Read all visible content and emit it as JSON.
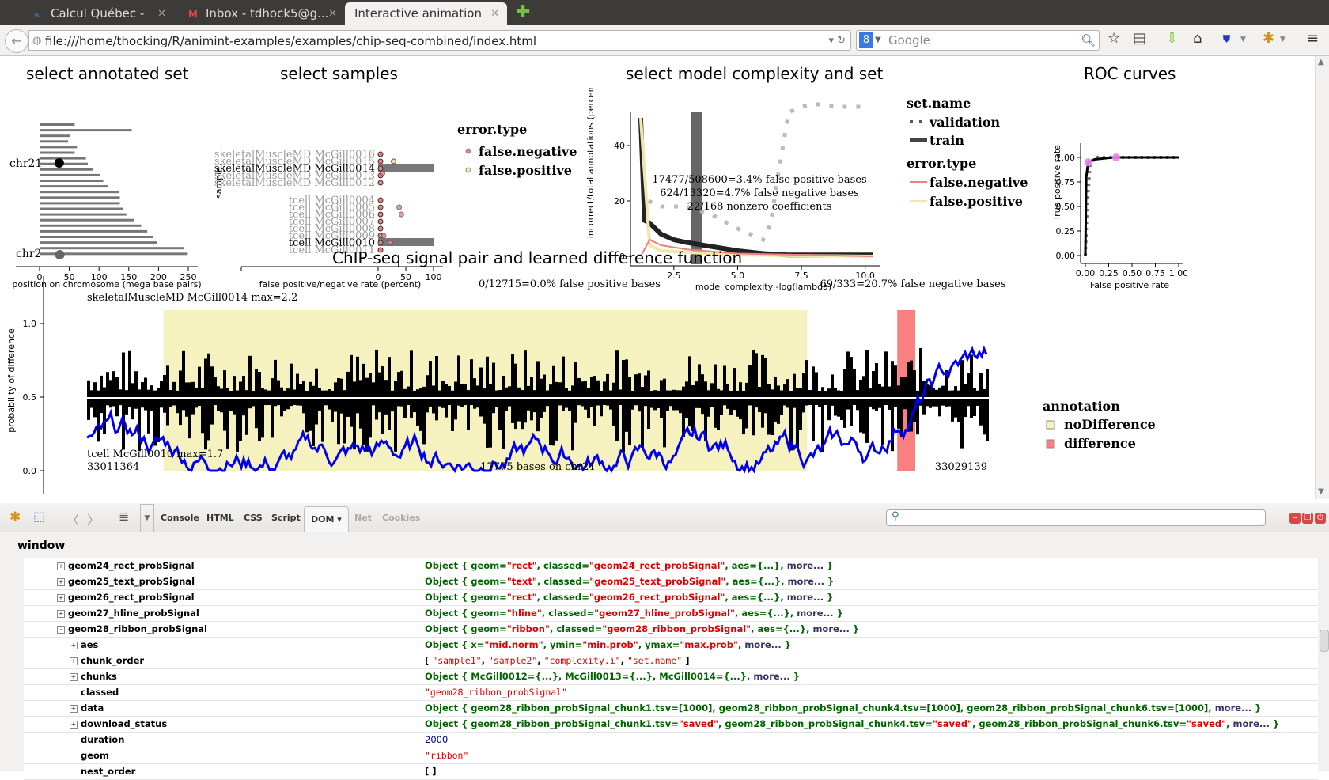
{
  "browser": {
    "tabs": [
      {
        "label": "Calcul Québec - Das...",
        "icon": "calculquebec-icon",
        "active": false
      },
      {
        "label": "Inbox - tdhock5@g...",
        "icon": "gmail-icon",
        "active": false
      },
      {
        "label": "Interactive animation",
        "icon": "",
        "active": true
      }
    ],
    "url": "file:///home/thocking/R/animint-examples/examples/chip-seq-combined/index.html",
    "search_placeholder": "Google"
  },
  "plots": {
    "annotated_set": {
      "title": "select annotated set",
      "xlabel": "position on chromosome (mega base pairs)",
      "xticks": [
        "0",
        "50",
        "100",
        "150",
        "200",
        "250"
      ],
      "labels": [
        "chr21",
        "chr2"
      ]
    },
    "samples": {
      "title": "select samples",
      "ylabel": "sample",
      "xlabel": "false positive/negative rate (percent)",
      "xticks": [
        "0",
        "50",
        "100"
      ],
      "samples": [
        {
          "name": "skeletalMuscleMD McGill0016",
          "selected": false
        },
        {
          "name": "skeletalMuscleMD McGill0015",
          "selected": false
        },
        {
          "name": "skeletalMuscleMD McGill0014",
          "selected": true
        },
        {
          "name": "skeletalMuscleMD McGill0013",
          "selected": false
        },
        {
          "name": "skeletalMuscleMD McGill0012",
          "selected": false
        },
        {
          "name": "tcell McGill0004",
          "selected": false
        },
        {
          "name": "tcell McGill0005",
          "selected": false
        },
        {
          "name": "tcell McGill0006",
          "selected": false
        },
        {
          "name": "tcell McGill0007",
          "selected": false
        },
        {
          "name": "tcell McGill0008",
          "selected": false
        },
        {
          "name": "tcell McGill0009",
          "selected": false
        },
        {
          "name": "tcell McGill0010",
          "selected": true
        },
        {
          "name": "tcell McGill0011",
          "selected": false
        }
      ],
      "legend": {
        "title": "error.type",
        "items": [
          {
            "label": "false.negative",
            "color": "#f08080"
          },
          {
            "label": "false.positive",
            "color": "#eee8aa"
          }
        ]
      }
    },
    "complexity": {
      "title": "select model complexity and set",
      "ylabel": "incorrect/total annotations (percent)",
      "xlabel": "model complexity -log(lambda)",
      "xticks": [
        "2.5",
        "5.0",
        "7.5",
        "10.0"
      ],
      "yticks": [
        "0",
        "20",
        "40"
      ],
      "annotations": [
        "17477/508600=3.4% false positive bases",
        "624/13320=4.7% false negative bases",
        "22/168 nonzero coefficients"
      ],
      "legend": {
        "set_title": "set.name",
        "set_items": [
          "validation",
          "train"
        ],
        "error_title": "error.type",
        "error_items": [
          {
            "label": "false.negative",
            "color": "#f08080"
          },
          {
            "label": "false.positive",
            "color": "#eee8aa"
          }
        ]
      }
    },
    "roc": {
      "title": "ROC curves",
      "ylabel": "True positive rate",
      "xlabel": "False positive rate",
      "xticks": [
        "0.00",
        "0.25",
        "0.50",
        "0.75",
        "1.00"
      ],
      "yticks": [
        "0.00",
        "0.25",
        "0.50",
        "0.75",
        "1.00"
      ]
    },
    "signal": {
      "title": "ChIP-seq signal pair and learned difference function",
      "ylabel": "probability of difference",
      "yticks": [
        "0.0",
        "0.5",
        "1.0"
      ],
      "top_label": "skeletalMuscleMD McGill0014 max=2.2",
      "bottom_label": "tcell McGill0010 max=1.7",
      "fp_text": "0/12715=0.0% false positive bases",
      "fn_text": "69/333=20.7% false negative bases",
      "start": "33011364",
      "end": "33029139",
      "span_text": "17775 bases on chr21",
      "legend": {
        "title": "annotation",
        "items": [
          {
            "label": "noDifference",
            "color": "#f5f2c0"
          },
          {
            "label": "difference",
            "color": "#f88080"
          }
        ]
      }
    }
  },
  "chart_data": [
    {
      "type": "bar",
      "title": "select annotated set",
      "xlabel": "position on chromosome (mega base pairs)",
      "xlim": [
        -40,
        260
      ],
      "chromosome_lengths_mbp": [
        59,
        155,
        51,
        48,
        63,
        59,
        78,
        81,
        90,
        102,
        107,
        115,
        133,
        135,
        135,
        141,
        146,
        159,
        171,
        181,
        191,
        198,
        243,
        249
      ],
      "points": [
        {
          "label": "chr21",
          "x": 33,
          "selected": true
        },
        {
          "label": "chr2",
          "x": 34,
          "selected": false
        }
      ]
    },
    {
      "type": "scatter",
      "title": "select samples",
      "xlabel": "false positive/negative rate (percent)",
      "xlim": [
        -250,
        100
      ]
    },
    {
      "type": "line",
      "title": "select model complexity and set",
      "xlabel": "model complexity -log(lambda)",
      "ylabel": "incorrect/total annotations (percent)",
      "xlim": [
        0.8,
        10.6
      ],
      "ylim": [
        -2,
        58
      ],
      "selected_x": 3.4,
      "series": [
        {
          "name": "validation total",
          "style": "dotted",
          "x": [
            1.5,
            2,
            3,
            4,
            5,
            6,
            6.3,
            6.6,
            7,
            7.5,
            8,
            9,
            10
          ],
          "y": [
            20,
            18,
            18,
            15,
            10,
            6,
            12,
            30,
            52,
            54,
            55,
            54,
            54
          ]
        },
        {
          "name": "train total",
          "style": "solid",
          "x": [
            1.2,
            1.35,
            1.55,
            2,
            2.5,
            3,
            4,
            5,
            6,
            7,
            8,
            10.3
          ],
          "y": [
            50,
            13,
            12,
            8,
            6,
            5,
            3.5,
            2,
            1,
            0.5,
            0.5,
            0.5
          ]
        },
        {
          "name": "false.positive",
          "style": "solid",
          "x": [
            1.2,
            1.55,
            2,
            3,
            5,
            10.3
          ],
          "y": [
            50,
            4,
            2,
            1.5,
            0.5,
            0
          ]
        },
        {
          "name": "false.negative",
          "style": "solid",
          "x": [
            1.2,
            1.55,
            2,
            3,
            5,
            10.3
          ],
          "y": [
            0,
            6,
            4,
            2.5,
            1,
            0
          ]
        }
      ]
    },
    {
      "type": "line",
      "title": "ROC curves",
      "xlabel": "False positive rate",
      "ylabel": "True positive rate",
      "xlim": [
        0,
        1
      ],
      "ylim": [
        0,
        1
      ],
      "series": [
        {
          "name": "train",
          "x": [
            0,
            0.01,
            0.03,
            0.1,
            0.3,
            1
          ],
          "y": [
            0,
            0.8,
            0.95,
            0.98,
            1,
            1
          ]
        },
        {
          "name": "validation",
          "x": [
            0,
            0.02,
            0.05,
            0.1,
            0.3,
            1
          ],
          "y": [
            0,
            0.5,
            0.92,
            1,
            1,
            1
          ]
        }
      ],
      "points": [
        {
          "x": 0.03,
          "y": 0.95
        },
        {
          "x": 0.33,
          "y": 1.0
        }
      ]
    },
    {
      "type": "area",
      "title": "ChIP-seq signal pair and learned difference function",
      "ylabel": "probability of difference",
      "ylim": [
        0,
        1.1
      ],
      "xlim": [
        33011364,
        33029139
      ],
      "annotations": [
        {
          "type": "noDifference",
          "start_frac": 0.085,
          "end_frac": 0.8
        },
        {
          "type": "difference",
          "start_frac": 0.9,
          "end_frac": 0.92
        }
      ]
    }
  ],
  "firebug": {
    "tabs": [
      "Console",
      "HTML",
      "CSS",
      "Script",
      "DOM",
      "Net",
      "Cookies"
    ],
    "active_tab": "DOM",
    "disabled_tabs": [
      "Net",
      "Cookies"
    ],
    "scope": "window",
    "rows": [
      {
        "indent": 1,
        "toggle": "+",
        "key": "geom24_rect_probSignal",
        "kind": "obj",
        "value": [
          [
            "Object { geom=",
            ""
          ],
          [
            "\"rect\"",
            "s"
          ],
          [
            ",  classed=",
            ""
          ],
          [
            "\"geom24_rect_probSignal\"",
            "s"
          ],
          [
            ",  aes={...},  ",
            ""
          ],
          [
            "more...",
            "m"
          ],
          [
            " }",
            ""
          ]
        ]
      },
      {
        "indent": 1,
        "toggle": "+",
        "key": "geom25_text_probSignal",
        "kind": "obj",
        "value": [
          [
            "Object { geom=",
            ""
          ],
          [
            "\"text\"",
            "s"
          ],
          [
            ",  classed=",
            ""
          ],
          [
            "\"geom25_text_probSignal\"",
            "s"
          ],
          [
            ",  aes={...},  ",
            ""
          ],
          [
            "more...",
            "m"
          ],
          [
            " }",
            ""
          ]
        ]
      },
      {
        "indent": 1,
        "toggle": "+",
        "key": "geom26_rect_probSignal",
        "kind": "obj",
        "value": [
          [
            "Object { geom=",
            ""
          ],
          [
            "\"rect\"",
            "s"
          ],
          [
            ",  classed=",
            ""
          ],
          [
            "\"geom26_rect_probSignal\"",
            "s"
          ],
          [
            ",  aes={...},  ",
            ""
          ],
          [
            "more...",
            "m"
          ],
          [
            " }",
            ""
          ]
        ]
      },
      {
        "indent": 1,
        "toggle": "+",
        "key": "geom27_hline_probSignal",
        "kind": "obj",
        "value": [
          [
            "Object { geom=",
            ""
          ],
          [
            "\"hline\"",
            "s"
          ],
          [
            ",  classed=",
            ""
          ],
          [
            "\"geom27_hline_probSignal\"",
            "s"
          ],
          [
            ",  aes={...},  ",
            ""
          ],
          [
            "more...",
            "m"
          ],
          [
            " }",
            ""
          ]
        ]
      },
      {
        "indent": 1,
        "toggle": "-",
        "key": "geom28_ribbon_probSignal",
        "kind": "obj",
        "value": [
          [
            "Object { geom=",
            ""
          ],
          [
            "\"ribbon\"",
            "s"
          ],
          [
            ",  classed=",
            ""
          ],
          [
            "\"geom28_ribbon_probSignal\"",
            "s"
          ],
          [
            ",  aes={...},  ",
            ""
          ],
          [
            "more...",
            "m"
          ],
          [
            " }",
            ""
          ]
        ]
      },
      {
        "indent": 2,
        "toggle": "+",
        "key": "aes",
        "kind": "obj",
        "value": [
          [
            "Object { x=",
            ""
          ],
          [
            "\"mid.norm\"",
            "s"
          ],
          [
            ",  ymin=",
            ""
          ],
          [
            "\"min.prob\"",
            "s"
          ],
          [
            ",  ymax=",
            ""
          ],
          [
            "\"max.prob\"",
            "s"
          ],
          [
            ",  ",
            ""
          ],
          [
            "more...",
            "m"
          ],
          [
            " }",
            ""
          ]
        ]
      },
      {
        "indent": 2,
        "toggle": "+",
        "key": "chunk_order",
        "kind": "arr",
        "value": [
          [
            "[ ",
            ""
          ],
          [
            "\"sample1\"",
            "s"
          ],
          [
            ", ",
            ""
          ],
          [
            "\"sample2\"",
            "s"
          ],
          [
            ", ",
            ""
          ],
          [
            "\"complexity.i\"",
            "s"
          ],
          [
            ", ",
            ""
          ],
          [
            "\"set.name\"",
            "s"
          ],
          [
            " ]",
            ""
          ]
        ]
      },
      {
        "indent": 2,
        "toggle": "+",
        "key": "chunks",
        "kind": "obj",
        "value": [
          [
            "Object {  McGill0012={...},   McGill0013={...},   McGill0014={...},   ",
            ""
          ],
          [
            "more...",
            "m"
          ],
          [
            " }",
            ""
          ]
        ]
      },
      {
        "indent": 2,
        "toggle": "",
        "key": "classed",
        "kind": "plain",
        "value": [
          [
            "\"geom28_ribbon_probSignal\"",
            ""
          ]
        ]
      },
      {
        "indent": 2,
        "toggle": "+",
        "key": "data",
        "kind": "obj",
        "value": [
          [
            "Object {  geom28_ribbon_probSignal_chunk1.tsv=[1000],   geom28_ribbon_probSignal_chunk4.tsv=[1000],   geom28_ribbon_probSignal_chunk6.tsv=[1000],   ",
            ""
          ],
          [
            "more...",
            "m"
          ],
          [
            " }",
            ""
          ]
        ]
      },
      {
        "indent": 2,
        "toggle": "+",
        "key": "download_status",
        "kind": "obj",
        "value": [
          [
            "Object {  geom28_ribbon_probSignal_chunk1.tsv=",
            ""
          ],
          [
            "\"saved\"",
            "s"
          ],
          [
            ",   geom28_ribbon_probSignal_chunk4.tsv=",
            ""
          ],
          [
            "\"saved\"",
            "s"
          ],
          [
            ",   geom28_ribbon_probSignal_chunk6.tsv=",
            ""
          ],
          [
            "\"saved\"",
            "s"
          ],
          [
            ",   ",
            ""
          ],
          [
            "more...",
            "m"
          ],
          [
            " }",
            ""
          ]
        ]
      },
      {
        "indent": 2,
        "toggle": "",
        "key": "duration",
        "kind": "num",
        "value": [
          [
            "2000",
            ""
          ]
        ]
      },
      {
        "indent": 2,
        "toggle": "",
        "key": "geom",
        "kind": "plain",
        "value": [
          [
            "\"ribbon\"",
            ""
          ]
        ]
      },
      {
        "indent": 2,
        "toggle": "",
        "key": "nest_order",
        "kind": "arr",
        "value": [
          [
            "[  ]",
            ""
          ]
        ]
      }
    ]
  }
}
